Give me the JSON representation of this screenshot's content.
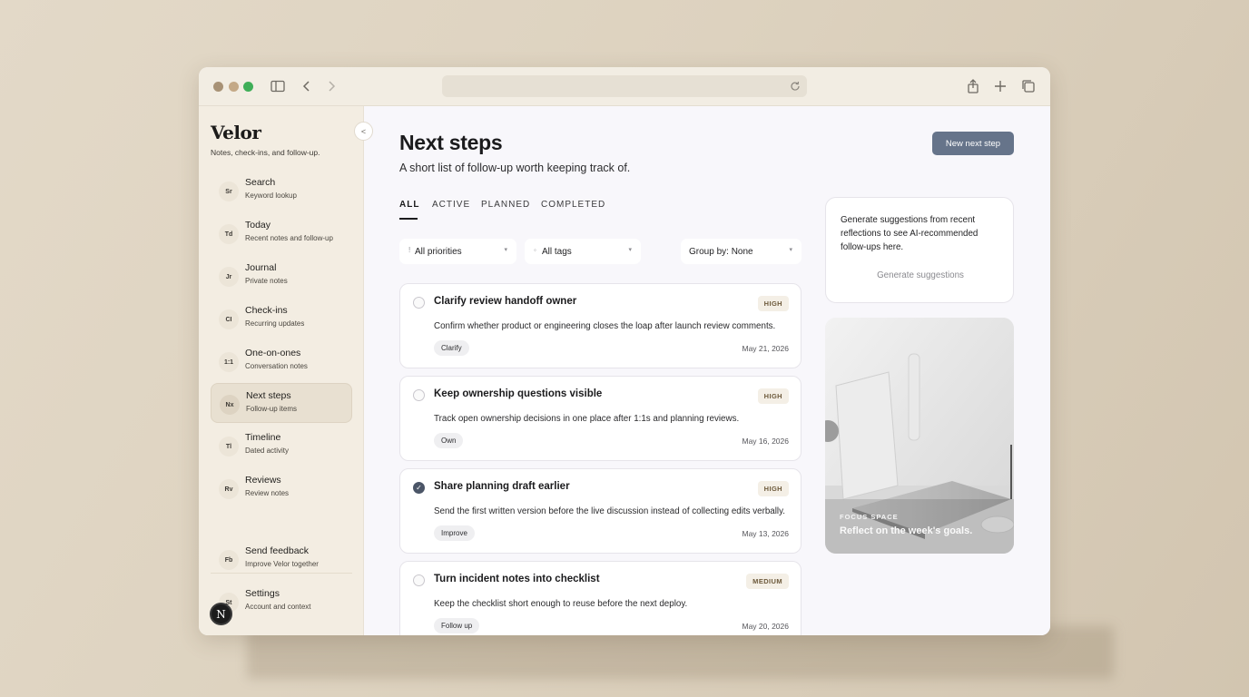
{
  "colors": {
    "accent": "#66748a",
    "sidebar_bg": "#f3ede2",
    "priority_text": "#6d5a3c",
    "traffic_red": "#a89276",
    "traffic_yellow": "#c4a987",
    "traffic_green": "#3fae58"
  },
  "browser": {
    "icons": [
      "sidebar-toggle-icon",
      "back-icon",
      "forward-icon",
      "reload-icon",
      "share-icon",
      "new-tab-icon",
      "tabs-overview-icon"
    ]
  },
  "sidebar": {
    "brand": "Velor",
    "tagline": "Notes, check-ins, and follow-up.",
    "collapse_glyph": "<",
    "items": [
      {
        "badge": "Sr",
        "label": "Search",
        "sub": "Keyword lookup"
      },
      {
        "badge": "Td",
        "label": "Today",
        "sub": "Recent notes and follow-up"
      },
      {
        "badge": "Jr",
        "label": "Journal",
        "sub": "Private notes"
      },
      {
        "badge": "CI",
        "label": "Check-ins",
        "sub": "Recurring updates"
      },
      {
        "badge": "1:1",
        "label": "One-on-ones",
        "sub": "Conversation notes"
      },
      {
        "badge": "Nx",
        "label": "Next steps",
        "sub": "Follow-up items"
      },
      {
        "badge": "Tl",
        "label": "Timeline",
        "sub": "Dated activity"
      },
      {
        "badge": "Rv",
        "label": "Reviews",
        "sub": "Review notes"
      }
    ],
    "footer": [
      {
        "badge": "Fb",
        "label": "Send feedback",
        "sub": "Improve Velor together"
      },
      {
        "badge": "St",
        "label": "Settings",
        "sub": "Account and context"
      }
    ],
    "avatar_letter": "N"
  },
  "main": {
    "title": "Next steps",
    "subtitle": "A short list of follow-up worth keeping track of.",
    "new_button": "New next step",
    "tabs": [
      "ALL",
      "ACTIVE",
      "PLANNED",
      "COMPLETED"
    ],
    "filters": {
      "priority": "All priorities",
      "tags": "All tags",
      "group": "Group by: None"
    },
    "cards": [
      {
        "title": "Clarify review handoff owner",
        "priority": "HIGH",
        "desc": "Confirm whether product or engineering closes the loap after launch review comments.",
        "tag": "Clarify",
        "date": "May 21, 2026",
        "done": false
      },
      {
        "title": "Keep ownership questions visible",
        "priority": "HIGH",
        "desc": "Track open ownership decisions in one place after 1:1s and planning reviews.",
        "tag": "Own",
        "date": "May 16, 2026",
        "done": false
      },
      {
        "title": "Share planning draft earlier",
        "priority": "HIGH",
        "desc": "Send the first written version before the live discussion instead of collecting edits verbally.",
        "tag": "Improve",
        "date": "May 13, 2026",
        "done": true
      },
      {
        "title": "Turn incident notes into checklist",
        "priority": "MEDIUM",
        "desc": "Keep the checklist short enough to reuse before the next deploy.",
        "tag": "Follow up",
        "date": "May 20, 2026",
        "done": false
      }
    ],
    "suggestions": {
      "text": "Generate suggestions from recent reflections to see AI-recommended follow-ups here.",
      "button": "Generate suggestions"
    },
    "focus": {
      "kicker": "FOCUS SPACE",
      "title": "Reflect on the week's goals."
    }
  }
}
